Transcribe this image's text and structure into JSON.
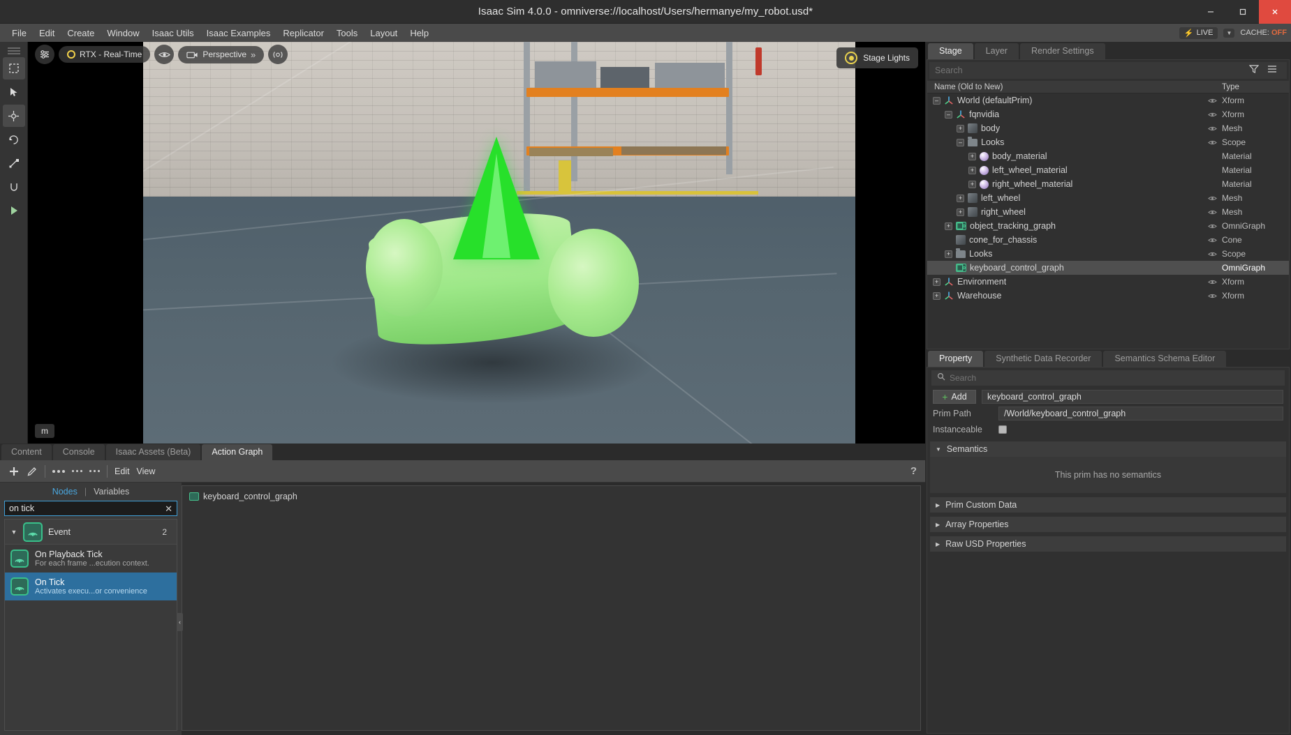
{
  "window": {
    "title": "Isaac Sim 4.0.0 - omniverse://localhost/Users/hermanye/my_robot.usd*",
    "minimize": "–",
    "maximize": "▢",
    "close": "✕"
  },
  "menubar": {
    "items": [
      "File",
      "Edit",
      "Create",
      "Window",
      "Isaac Utils",
      "Isaac Examples",
      "Replicator",
      "Tools",
      "Layout",
      "Help"
    ],
    "live_label": "LIVE",
    "cache_label": "CACHE:",
    "cache_state": "OFF"
  },
  "viewport": {
    "render_mode": "RTX - Real-Time",
    "camera": "Perspective",
    "stage_lights": "Stage Lights",
    "units": "m"
  },
  "stage": {
    "tabs": [
      {
        "label": "Stage",
        "active": true
      },
      {
        "label": "Layer",
        "active": false
      },
      {
        "label": "Render Settings",
        "active": false
      }
    ],
    "search_placeholder": "Search",
    "columns": {
      "name": "Name (Old to New)",
      "type": "Type"
    },
    "rows": [
      {
        "name": "World (defaultPrim)",
        "type": "Xform",
        "depth": 0,
        "expander": "minus",
        "icon": "xform-icon",
        "eye": true,
        "selected": false
      },
      {
        "name": "fqnvidia",
        "type": "Xform",
        "depth": 1,
        "expander": "minus",
        "icon": "xform-icon",
        "eye": true,
        "selected": false
      },
      {
        "name": "body",
        "type": "Mesh",
        "depth": 2,
        "expander": "plus",
        "icon": "mesh-icon",
        "eye": true,
        "selected": false
      },
      {
        "name": "Looks",
        "type": "Scope",
        "depth": 2,
        "expander": "minus",
        "icon": "scope-icon",
        "eye": true,
        "selected": false
      },
      {
        "name": "body_material",
        "type": "Material",
        "depth": 3,
        "expander": "plus",
        "icon": "material-icon",
        "eye": false,
        "selected": false
      },
      {
        "name": "left_wheel_material",
        "type": "Material",
        "depth": 3,
        "expander": "plus",
        "icon": "material-icon",
        "eye": false,
        "selected": false
      },
      {
        "name": "right_wheel_material",
        "type": "Material",
        "depth": 3,
        "expander": "plus",
        "icon": "material-icon",
        "eye": false,
        "selected": false
      },
      {
        "name": "left_wheel",
        "type": "Mesh",
        "depth": 2,
        "expander": "plus",
        "icon": "mesh-icon",
        "eye": true,
        "selected": false
      },
      {
        "name": "right_wheel",
        "type": "Mesh",
        "depth": 2,
        "expander": "plus",
        "icon": "mesh-icon",
        "eye": true,
        "selected": false
      },
      {
        "name": "object_tracking_graph",
        "type": "OmniGraph",
        "depth": 1,
        "expander": "plus",
        "icon": "graph-icon",
        "eye": true,
        "selected": false
      },
      {
        "name": "cone_for_chassis",
        "type": "Cone",
        "depth": 1,
        "expander": "none",
        "icon": "mesh-icon",
        "eye": true,
        "selected": false
      },
      {
        "name": "Looks",
        "type": "Scope",
        "depth": 1,
        "expander": "plus",
        "icon": "scope-icon",
        "eye": true,
        "selected": false
      },
      {
        "name": "keyboard_control_graph",
        "type": "OmniGraph",
        "depth": 1,
        "expander": "none",
        "icon": "graph-icon",
        "eye": false,
        "selected": true
      },
      {
        "name": "Environment",
        "type": "Xform",
        "depth": 0,
        "expander": "plus",
        "icon": "xform-icon",
        "eye": true,
        "selected": false
      },
      {
        "name": "Warehouse",
        "type": "Xform",
        "depth": 0,
        "expander": "plus",
        "icon": "xform-icon",
        "eye": true,
        "selected": false
      }
    ]
  },
  "property": {
    "tabs": [
      {
        "label": "Property",
        "active": true
      },
      {
        "label": "Synthetic Data Recorder",
        "active": false
      },
      {
        "label": "Semantics Schema Editor",
        "active": false
      }
    ],
    "search_placeholder": "Search",
    "add_label": "Add",
    "prim_name": "keyboard_control_graph",
    "prim_path_label": "Prim Path",
    "prim_path_value": "/World/keyboard_control_graph",
    "instanceable_label": "Instanceable",
    "semantics_label": "Semantics",
    "semantics_empty": "This prim has no semantics",
    "sections": [
      "Prim Custom Data",
      "Array Properties",
      "Raw USD Properties"
    ]
  },
  "bottom": {
    "tabs": [
      {
        "label": "Content",
        "active": false
      },
      {
        "label": "Console",
        "active": false
      },
      {
        "label": "Isaac Assets (Beta)",
        "active": false
      },
      {
        "label": "Action Graph",
        "active": true
      }
    ],
    "toolbar": {
      "edit": "Edit",
      "view": "View",
      "help": "?"
    },
    "nodes_tab": "Nodes",
    "variables_tab": "Variables",
    "tab_separator": "|",
    "search_value": "on tick",
    "clear_icon": "✕",
    "category": {
      "name": "Event",
      "count": "2"
    },
    "nodes": [
      {
        "title": "On Playback Tick",
        "desc": "For each frame ...ecution context.",
        "selected": false
      },
      {
        "title": "On Tick",
        "desc": "Activates execu...or convenience",
        "selected": true
      }
    ],
    "graph_breadcrumb": "keyboard_control_graph"
  },
  "colors": {
    "accent_blue": "#2d6f9e",
    "graph_green": "#39c08a",
    "cache_off": "#e06a3f",
    "live_yellow": "#f5c518"
  }
}
